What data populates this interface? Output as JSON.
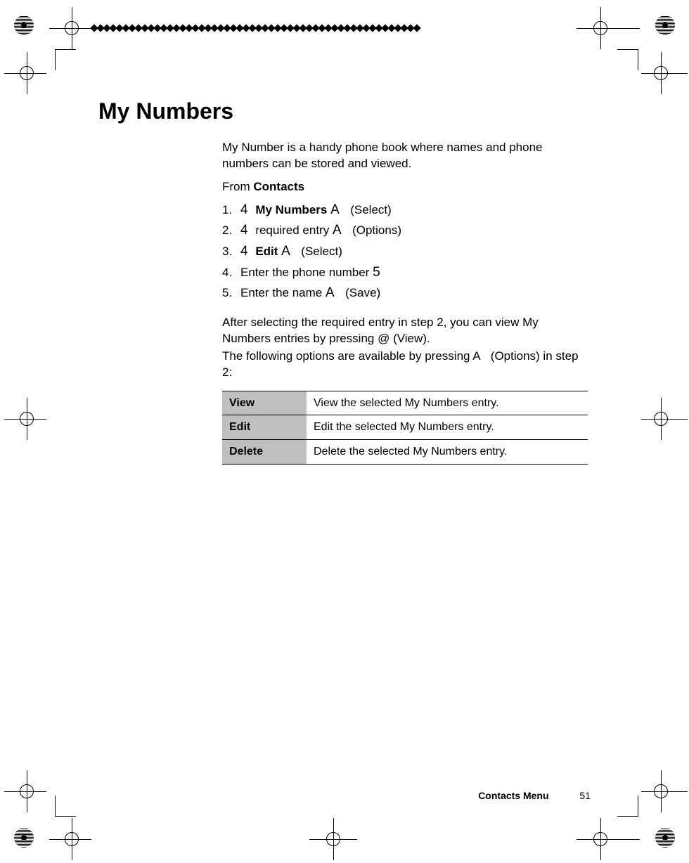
{
  "title": "My Numbers",
  "intro": "My Number is a handy phone book where names and phone numbers can be stored and viewed.",
  "from_prefix": "From ",
  "from_bold": "Contacts",
  "steps": [
    {
      "n": "1.",
      "sym": "4",
      "bold": "My Numbers",
      "tail_sym": "A",
      "paren": "(Select)"
    },
    {
      "n": "2.",
      "sym": "4",
      "plain": " required entry",
      "tail_sym": "A",
      "paren": "(Options)"
    },
    {
      "n": "3.",
      "sym": "4",
      "bold": "Edit",
      "tail_sym": "A",
      "paren": "(Select)"
    },
    {
      "n": "4.",
      "plain": "Enter the phone number",
      "tail_sym": "5"
    },
    {
      "n": "5.",
      "plain": "Enter the name",
      "tail_sym": "A",
      "paren": "(Save)"
    }
  ],
  "after1": "After selecting the required entry in step 2, you can view My Numbers entries by pressing @   (View).",
  "after2_a": "The following options are available by pressing ",
  "after2_sym": "A",
  "after2_b": " (Options) in step 2:",
  "options_table": [
    {
      "k": "View",
      "v": "View the selected My Numbers entry."
    },
    {
      "k": "Edit",
      "v": "Edit the selected My Numbers entry."
    },
    {
      "k": "Delete",
      "v": "Delete the selected My Numbers entry."
    }
  ],
  "footer_section": "Contacts Menu",
  "footer_page": "51"
}
